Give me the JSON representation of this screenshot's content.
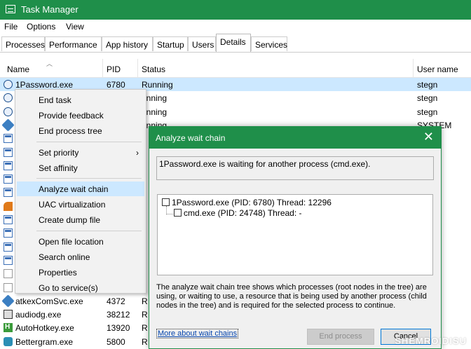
{
  "window": {
    "title": "Task Manager"
  },
  "menu": [
    "File",
    "Options",
    "View"
  ],
  "tabs": [
    "Processes",
    "Performance",
    "App history",
    "Startup",
    "Users",
    "Details",
    "Services"
  ],
  "active_tab": "Details",
  "columns": {
    "name": "Name",
    "pid": "PID",
    "status": "Status",
    "user": "User name"
  },
  "rows": [
    {
      "icon": "1password-icon",
      "name": "1Password.exe",
      "pid": "6780",
      "status": "Running",
      "user": "stegn",
      "selected": true
    },
    {
      "icon": "1password-icon",
      "name": "",
      "pid": "",
      "status": "unning",
      "user": "stegn"
    },
    {
      "icon": "1password-icon",
      "name": "",
      "pid": "",
      "status": "unning",
      "user": "stegn"
    },
    {
      "icon": "gear-icon",
      "name": "",
      "pid": "",
      "status": "unning",
      "user": "SYSTEM"
    },
    {
      "icon": "window-icon",
      "name": "",
      "pid": "",
      "status": "",
      "user": "M"
    },
    {
      "icon": "window-icon",
      "name": "",
      "pid": "",
      "status": "",
      "user": "M"
    },
    {
      "icon": "window-icon",
      "name": "",
      "pid": "",
      "status": "",
      "user": ""
    },
    {
      "icon": "window-icon",
      "name": "",
      "pid": "",
      "status": "",
      "user": ""
    },
    {
      "icon": "window-icon",
      "name": "",
      "pid": "",
      "status": "",
      "user": ""
    },
    {
      "icon": "orange-icon",
      "name": "",
      "pid": "",
      "status": "",
      "user": ""
    },
    {
      "icon": "window-icon",
      "name": "",
      "pid": "",
      "status": "",
      "user": ""
    },
    {
      "icon": "window-icon",
      "name": "",
      "pid": "",
      "status": "",
      "user": "M"
    },
    {
      "icon": "window-icon",
      "name": "",
      "pid": "",
      "status": "",
      "user": "M"
    },
    {
      "icon": "window-icon",
      "name": "",
      "pid": "",
      "status": "",
      "user": "M"
    },
    {
      "icon": "document-icon",
      "name": "",
      "pid": "",
      "status": "",
      "user": "M"
    },
    {
      "icon": "document-icon",
      "name": "",
      "pid": "",
      "status": "",
      "user": "M"
    },
    {
      "icon": "gear-icon",
      "name": "atkexComSvc.exe",
      "pid": "4372",
      "status": "R",
      "user": "M"
    },
    {
      "icon": "speaker-icon",
      "name": "audiodg.exe",
      "pid": "38212",
      "status": "R",
      "user": "L SE..."
    },
    {
      "icon": "autohotkey-icon",
      "name": "AutoHotkey.exe",
      "pid": "13920",
      "status": "R",
      "user": ""
    },
    {
      "icon": "bettergram-icon",
      "name": "Bettergram.exe",
      "pid": "5800",
      "status": "R",
      "user": ""
    }
  ],
  "context_menu": {
    "items": [
      {
        "label": "End task",
        "group": 0
      },
      {
        "label": "Provide feedback",
        "group": 0
      },
      {
        "label": "End process tree",
        "group": 0
      },
      {
        "label": "Set priority",
        "group": 1,
        "submenu": true
      },
      {
        "label": "Set affinity",
        "group": 1
      },
      {
        "label": "Analyze wait chain",
        "group": 2,
        "highlighted": true
      },
      {
        "label": "UAC virtualization",
        "group": 2
      },
      {
        "label": "Create dump file",
        "group": 2
      },
      {
        "label": "Open file location",
        "group": 3
      },
      {
        "label": "Search online",
        "group": 3
      },
      {
        "label": "Properties",
        "group": 3
      },
      {
        "label": "Go to service(s)",
        "group": 3
      }
    ],
    "submenu_arrow": "›"
  },
  "dialog": {
    "title": "Analyze wait chain",
    "close": "✕",
    "message": "1Password.exe is waiting for another process (cmd.exe).",
    "tree": [
      "1Password.exe (PID: 6780) Thread: 12296",
      "cmd.exe (PID: 24748) Thread: -"
    ],
    "description": "The analyze wait chain tree shows which processes (root nodes in the tree) are using, or waiting to use, a resource that is being used by another process (child nodes in the tree) and is required for the selected process to continue.",
    "link": "More about wait chains",
    "end_process": "End process",
    "cancel": "Cancel"
  },
  "watermark": "SHEMROIDISU",
  "colors": {
    "accent": "#1f8f4a",
    "selection": "#cce8ff",
    "link": "#0645ad"
  }
}
